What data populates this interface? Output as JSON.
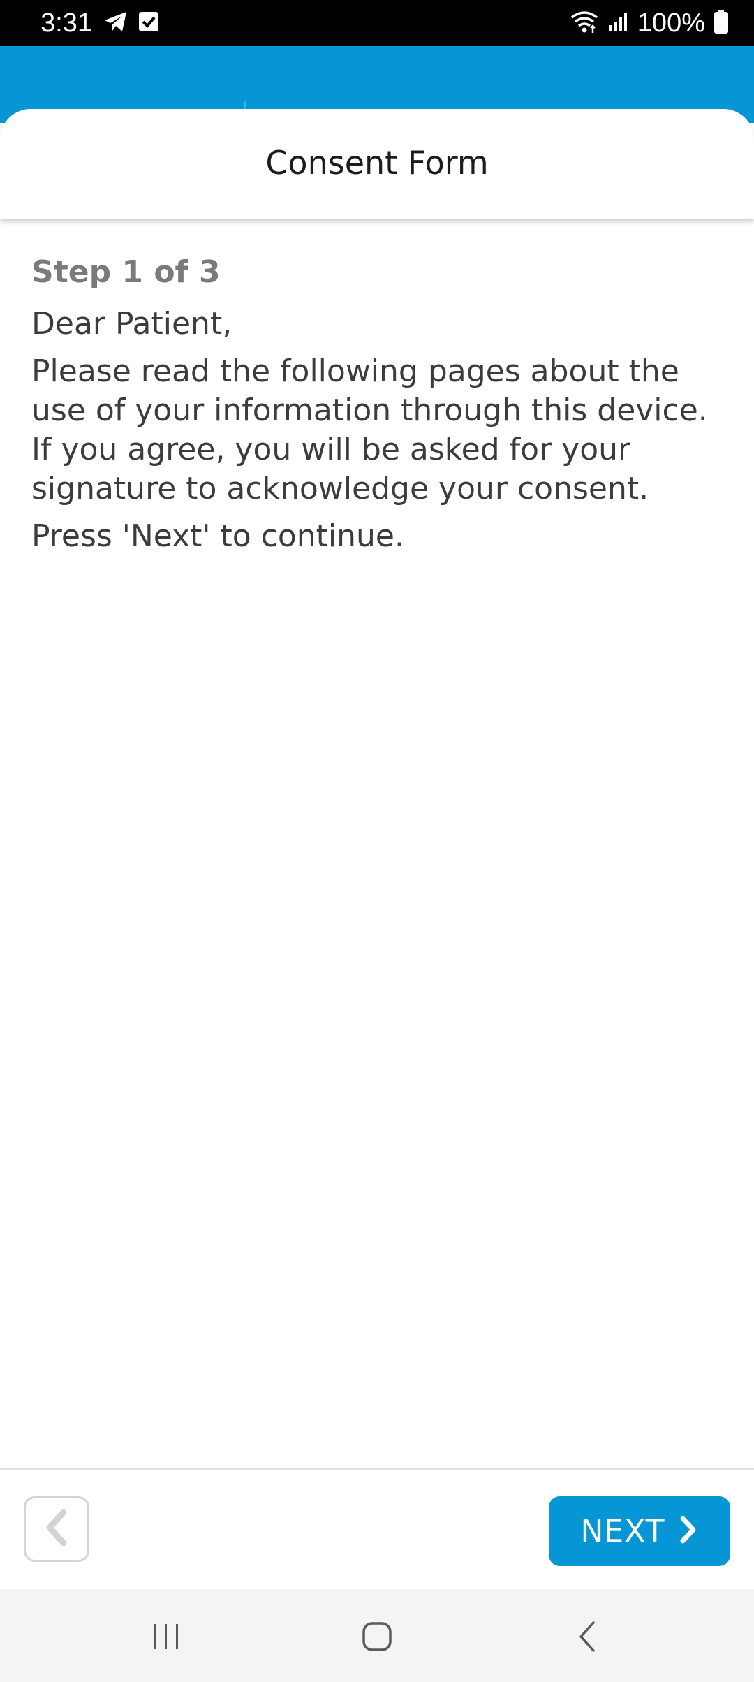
{
  "status_bar": {
    "time": "3:31",
    "battery": "100%",
    "icons": [
      "telegram-icon",
      "check-box-icon",
      "wifi-icon",
      "signal-icon",
      "battery-icon"
    ]
  },
  "sheet": {
    "title": "Consent Form"
  },
  "content": {
    "step": "Step 1 of 3",
    "greeting": "Dear Patient,",
    "body": "Please read the following pages about the use of your information through this device. If you agree, you will be asked for your signature to acknowledge your consent.",
    "instruction": "Press 'Next' to continue."
  },
  "footer": {
    "back_icon": "chevron-left-icon",
    "next_label": "NEXT",
    "next_icon": "chevron-right-icon"
  },
  "nav_bar": {
    "icons": [
      "recent-apps-icon",
      "home-icon",
      "back-icon"
    ]
  },
  "colors": {
    "accent": "#0696d6",
    "text": "#3c3c3c",
    "step_text": "#7a7a7a"
  }
}
